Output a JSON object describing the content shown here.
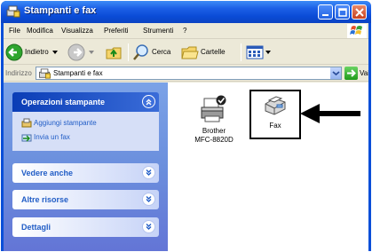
{
  "window": {
    "title": "Stampanti e fax"
  },
  "menu": {
    "items": [
      "File",
      "Modifica",
      "Visualizza",
      "Preferiti",
      "Strumenti",
      "?"
    ]
  },
  "toolbar": {
    "back_label": "Indietro",
    "search_label": "Cerca",
    "folders_label": "Cartelle"
  },
  "address": {
    "label": "Indirizzo",
    "value": "Stampanti e fax",
    "go_label": "Vai"
  },
  "taskpane": {
    "printer_tasks": {
      "title": "Operazioni stampante",
      "links": [
        "Aggiungi stampante",
        "Invia un fax"
      ]
    },
    "see_also": {
      "title": "Vedere anche"
    },
    "other_places": {
      "title": "Altre risorse"
    },
    "details": {
      "title": "Dettagli"
    }
  },
  "items": {
    "printer": {
      "line1": "Brother",
      "line2": "MFC-8820D"
    },
    "fax": {
      "label": "Fax"
    }
  },
  "colors": {
    "titlebar": "#0a4fd8",
    "taskpane": "#6b8fdd",
    "link": "#215dc6"
  }
}
